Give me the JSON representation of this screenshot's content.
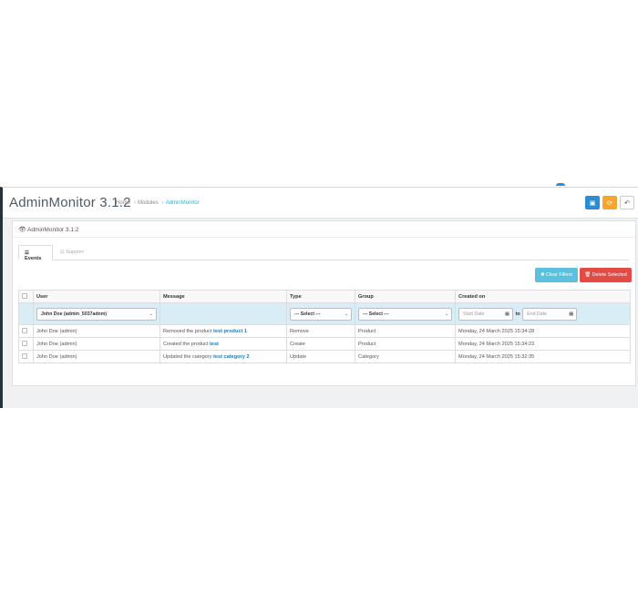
{
  "header": {
    "title": "AdminMonitor 3.1.2",
    "breadcrumb": [
      "Home",
      "Modules",
      "AdminMonitor"
    ],
    "toolbar": {
      "save_icon": "save-icon",
      "refresh_icon": "refresh-icon",
      "back_icon": "back-icon"
    }
  },
  "panel": {
    "title": "AdminMonitor 3.1.2",
    "tabs": [
      {
        "label": "Events",
        "active": true
      },
      {
        "label": "Support",
        "active": false
      }
    ],
    "buttons": {
      "clear_filters": "Clear Filters",
      "delete_selected": "Delete Selected"
    }
  },
  "table": {
    "columns": [
      "User",
      "Message",
      "Type",
      "Group",
      "Created on"
    ],
    "filters": {
      "user": "John Doe (admin_5037adnm)",
      "type": "--- Select ---",
      "group": "--- Select ---",
      "date_start_placeholder": "Start Date",
      "date_to": "to",
      "date_end_placeholder": "End Date"
    },
    "rows": [
      {
        "user": "John Doe (admin)",
        "message_text": "Removed the product ",
        "message_link": "test product 1",
        "type": "Remove",
        "group": "Product",
        "created": "Monday, 24 March 2025 15:34:28"
      },
      {
        "user": "John Doe (admin)",
        "message_text": "Created the product ",
        "message_link": "test",
        "type": "Create",
        "group": "Product",
        "created": "Monday, 24 March 2025 15:34:23"
      },
      {
        "user": "John Doe (admin)",
        "message_text": "Updated the category ",
        "message_link": "test category 2",
        "type": "Update",
        "group": "Category",
        "created": "Monday, 24 March 2025 15:32:35"
      }
    ]
  },
  "colors": {
    "accent": "#25b9d7",
    "save": "#2a8dd4",
    "refresh": "#f6a62b",
    "info": "#5bc0de",
    "danger": "#e14b43",
    "filter_row": "#d9edf7"
  }
}
